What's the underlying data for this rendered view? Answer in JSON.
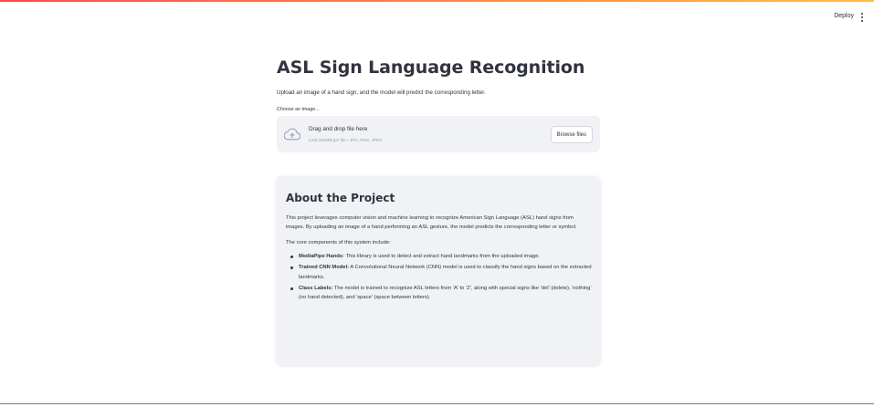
{
  "header": {
    "deploy_label": "Deploy",
    "menu_icon": "vertical-dots-icon"
  },
  "main": {
    "title": "ASL Sign Language Recognition",
    "subtitle": "Upload an image of a hand sign, and the model will predict the corresponding letter.",
    "uploader": {
      "label": "Choose an image...",
      "icon": "cloud-upload-icon",
      "dropzone_title": "Drag and drop file here",
      "limit_text": "Limit 200MB per file • JPG, PNG, JPEG",
      "browse_label": "Browse files"
    }
  },
  "about": {
    "title": "About the Project",
    "description": "This project leverages computer vision and machine learning to recognize American Sign Language (ASL) hand signs from images. By uploading an image of a hand performing an ASL gesture, the model predicts the corresponding letter or symbol.",
    "core_intro": "The core components of this system include:",
    "components": [
      {
        "name": "MediaPipe Hands:",
        "text": " This library is used to detect and extract hand landmarks from the uploaded image."
      },
      {
        "name": "Trained CNN Model:",
        "text": " A Convolutional Neural Network (CNN) model is used to classify the hand signs based on the extracted landmarks."
      },
      {
        "name": "Class Labels:",
        "text": " The model is trained to recognize ASL letters from 'A' to 'Z', along with special signs like 'del' (delete), 'nothing' (no hand detected), and 'space' (space between letters)."
      }
    ]
  },
  "colors": {
    "accent_start": "#ff4b4b",
    "accent_end": "#ffbd45",
    "text": "#31333f",
    "panel_bg": "#f0f2f6"
  }
}
